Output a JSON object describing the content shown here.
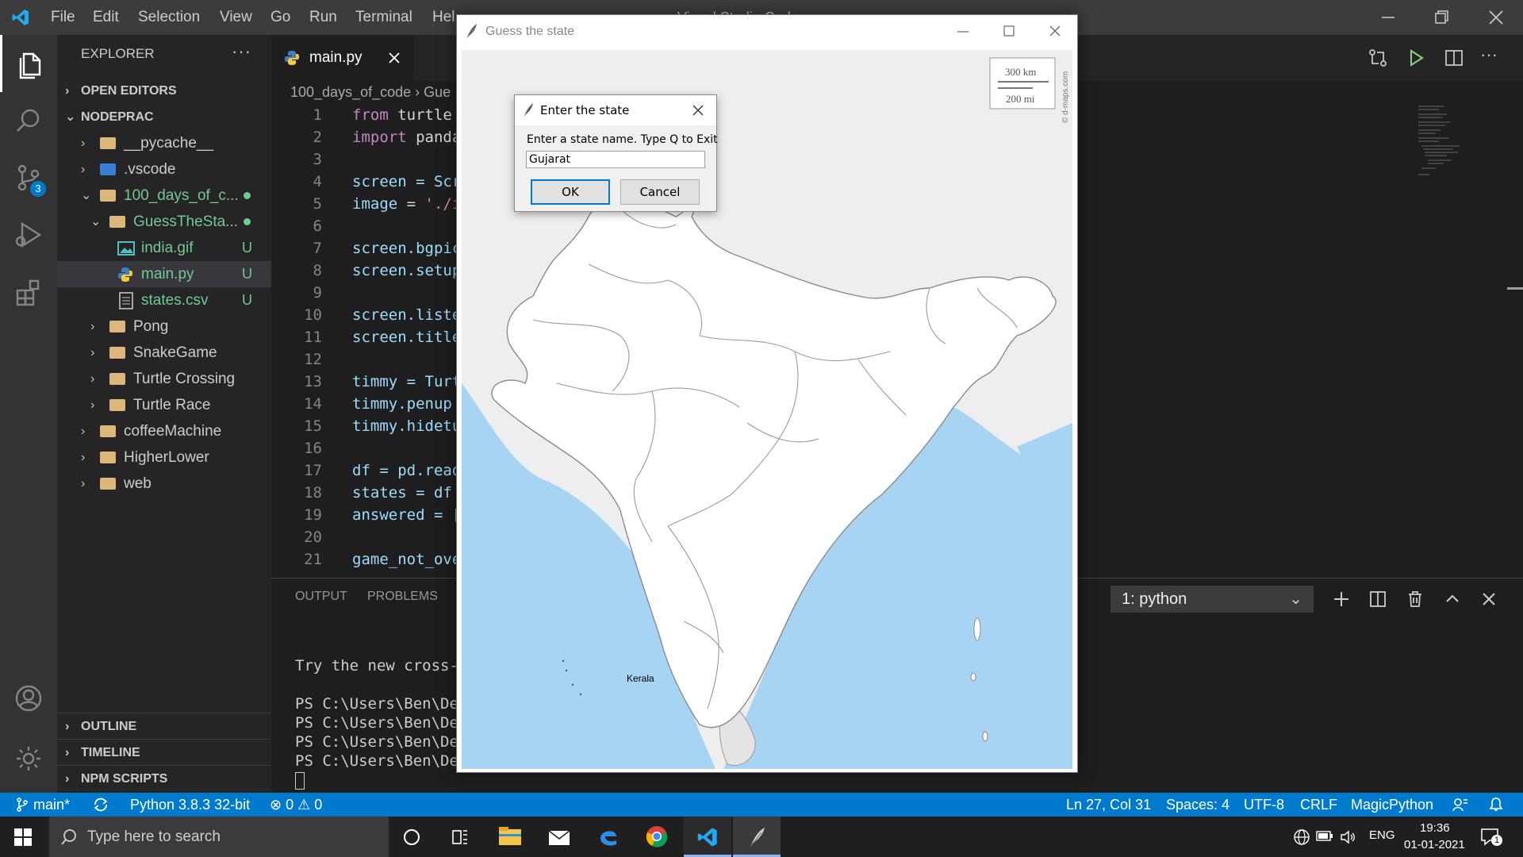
{
  "app": {
    "window_title": "… - Visual Studio Code"
  },
  "menu": [
    "File",
    "Edit",
    "Selection",
    "View",
    "Go",
    "Run",
    "Terminal",
    "Hel"
  ],
  "explorer": {
    "title": "EXPLORER",
    "more": "···",
    "open_editors": "OPEN EDITORS",
    "project": "NODEPRAC",
    "tree": [
      {
        "label": "__pycache__",
        "status": ""
      },
      {
        "label": ".vscode",
        "status": ""
      },
      {
        "label": "100_days_of_c...",
        "status": ""
      },
      {
        "label": "GuessTheSta...",
        "status": ""
      },
      {
        "label": "india.gif",
        "status": "U"
      },
      {
        "label": "main.py",
        "status": "U"
      },
      {
        "label": "states.csv",
        "status": "U"
      },
      {
        "label": "Pong",
        "status": ""
      },
      {
        "label": "SnakeGame",
        "status": ""
      },
      {
        "label": "Turtle Crossing",
        "status": ""
      },
      {
        "label": "Turtle Race",
        "status": ""
      },
      {
        "label": "coffeeMachine",
        "status": ""
      },
      {
        "label": "HigherLower",
        "status": ""
      },
      {
        "label": "web",
        "status": ""
      }
    ],
    "outline": "OUTLINE",
    "timeline": "TIMELINE",
    "npm": "NPM SCRIPTS"
  },
  "source_control_badge": "3",
  "editor": {
    "tab": "main.py",
    "breadcrumb": "100_days_of_code › Gue",
    "lines": [
      {
        "n": "1",
        "t": "from turtle"
      },
      {
        "n": "2",
        "t": "import panda"
      },
      {
        "n": "3",
        "t": ""
      },
      {
        "n": "4",
        "t": "screen = Scr"
      },
      {
        "n": "5",
        "t": "image = './i"
      },
      {
        "n": "6",
        "t": ""
      },
      {
        "n": "7",
        "t": "screen.bgpic"
      },
      {
        "n": "8",
        "t": "screen.setup"
      },
      {
        "n": "9",
        "t": ""
      },
      {
        "n": "10",
        "t": "screen.liste"
      },
      {
        "n": "11",
        "t": "screen.title"
      },
      {
        "n": "12",
        "t": ""
      },
      {
        "n": "13",
        "t": "timmy = Turt"
      },
      {
        "n": "14",
        "t": "timmy.penup"
      },
      {
        "n": "15",
        "t": "timmy.hidetu"
      },
      {
        "n": "16",
        "t": ""
      },
      {
        "n": "17",
        "t": "df = pd.read"
      },
      {
        "n": "18",
        "t": "states = df"
      },
      {
        "n": "19",
        "t": "answered = ["
      },
      {
        "n": "20",
        "t": ""
      },
      {
        "n": "21",
        "t": "game_not_ove"
      }
    ]
  },
  "panel": {
    "tabs": [
      "OUTPUT",
      "PROBLEMS"
    ],
    "terminal_select": "1: python",
    "terminal_lines": [
      "Try the new cross-p",
      "",
      "PS C:\\Users\\Ben\\Des",
      "PS C:\\Users\\Ben\\Des",
      "PS C:\\Users\\Ben\\Des",
      "PS C:\\Users\\Ben\\Des"
    ]
  },
  "statusbar": {
    "branch": "main*",
    "python": "Python 3.8.3 32-bit",
    "errors": "0",
    "warnings": "0",
    "position": "Ln 27, Col 31",
    "spaces": "Spaces: 4",
    "encoding": "UTF-8",
    "eol": "CRLF",
    "language": "MagicPython"
  },
  "tk_window": {
    "title": "Guess the state",
    "scale_km": "300 km",
    "scale_mi": "200 mi",
    "watermark": "© d-maps.com",
    "state_label": "Kerala"
  },
  "dialog": {
    "title": "Enter the state",
    "prompt": "Enter a state name. Type Q to Exit",
    "value": "Gujarat",
    "ok": "OK",
    "cancel": "Cancel"
  },
  "taskbar": {
    "search_placeholder": "Type here to search",
    "lang": "ENG",
    "time": "19:36",
    "date": "01-01-2021",
    "notification_count": "1"
  },
  "colors": {
    "vscode_blue": "#007acc",
    "sea": "#a6d4f2",
    "land": "#ffffff"
  }
}
